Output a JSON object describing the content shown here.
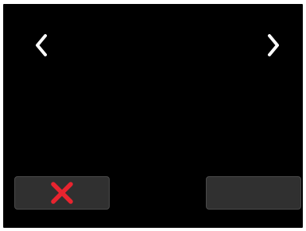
{
  "screen": {
    "background": "#000000"
  },
  "navigation": {
    "previous_icon": "chevron-left-icon",
    "next_icon": "chevron-right-icon",
    "icon_color": "#ffffff"
  },
  "actions": {
    "cancel_icon": "close-icon",
    "cancel_icon_color": "#e8242f",
    "button_color": "#303030",
    "confirm_label": ""
  }
}
